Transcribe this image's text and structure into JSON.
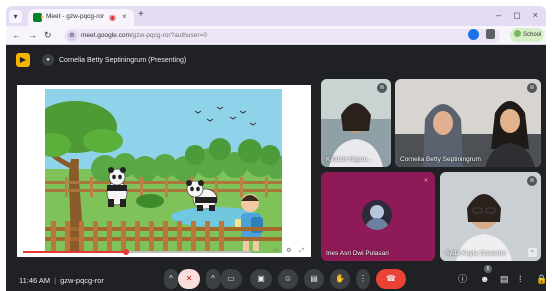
{
  "browser": {
    "tab_title": "Meet - gzw-pqcg-ror",
    "url_domain": "meet.google.com",
    "url_path": "/gzw-pqcg-ror?authuser=0",
    "profile_label": "School",
    "tab_close": "×",
    "new_tab": "+",
    "minimize": "–",
    "maximize": "◻",
    "close": "×"
  },
  "meet": {
    "presenter_label": "Cornelia Betty Septiningrum (Presenting)",
    "meeting_time": "11:46 AM",
    "meeting_code": "gzw-pqcg-ror",
    "participant_count": "6"
  },
  "participants": [
    {
      "name": "Kirantri Hayun..."
    },
    {
      "name": "Cornelia Betty Septiningrum"
    },
    {
      "name": "Ines Asri Dwi Pulasari"
    },
    {
      "name": "Ayda Keyla Siswanto"
    }
  ],
  "colors": {
    "meet_bg": "#202124",
    "control_bg": "#3c4043",
    "end_call": "#ea4335",
    "present_badge": "#f4b400",
    "tabbar": "#e3dcf3"
  },
  "video_player": {
    "progress": 0.45
  }
}
